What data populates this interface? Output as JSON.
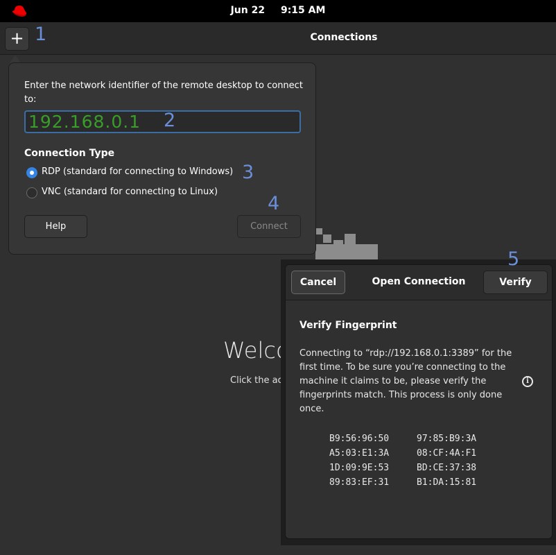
{
  "topbar": {
    "date": "Jun 22",
    "time": "9:15 AM"
  },
  "header": {
    "add_button_label": "+",
    "title": "Connections"
  },
  "annotations": [
    "1",
    "2",
    "3",
    "4",
    "5"
  ],
  "popover": {
    "prompt": "Enter the network identifier of the remote desktop to connect to:",
    "address_value": "192.168.0.1",
    "connection_type_title": "Connection Type",
    "options": [
      {
        "label": "RDP (standard for connecting to Windows)",
        "selected": true
      },
      {
        "label": "VNC (standard for connecting to Linux)",
        "selected": false
      }
    ],
    "help_label": "Help",
    "connect_label": "Connect"
  },
  "welcome": {
    "title": "Welco",
    "subtitle": "Click the ac"
  },
  "dialog": {
    "cancel_label": "Cancel",
    "title": "Open Connection",
    "verify_label": "Verify",
    "heading": "Verify Fingerprint",
    "body": "Connecting to “rdp://192.168.0.1:3389” for the first time. To be sure you’re connecting to the machine it claims to be, please verify the fingerprints match. This process is only done once.",
    "info_icon": "i",
    "fingerprints": [
      [
        "B9:56:96:50",
        "97:85:B9:3A"
      ],
      [
        "A5:03:E1:3A",
        "08:CF:4A:F1"
      ],
      [
        "1D:09:9E:53",
        "BD:CE:37:38"
      ],
      [
        "89:83:EF:31",
        "B1:DA:15:81"
      ]
    ]
  },
  "colors": {
    "accent": "#3584e4",
    "annotation": "#6b8ed9",
    "address_text": "#3a9c2a",
    "logo_red": "#ee0000"
  },
  "icons": {
    "logo": "redhat-logo-icon",
    "add": "plus-icon",
    "info": "info-icon"
  }
}
